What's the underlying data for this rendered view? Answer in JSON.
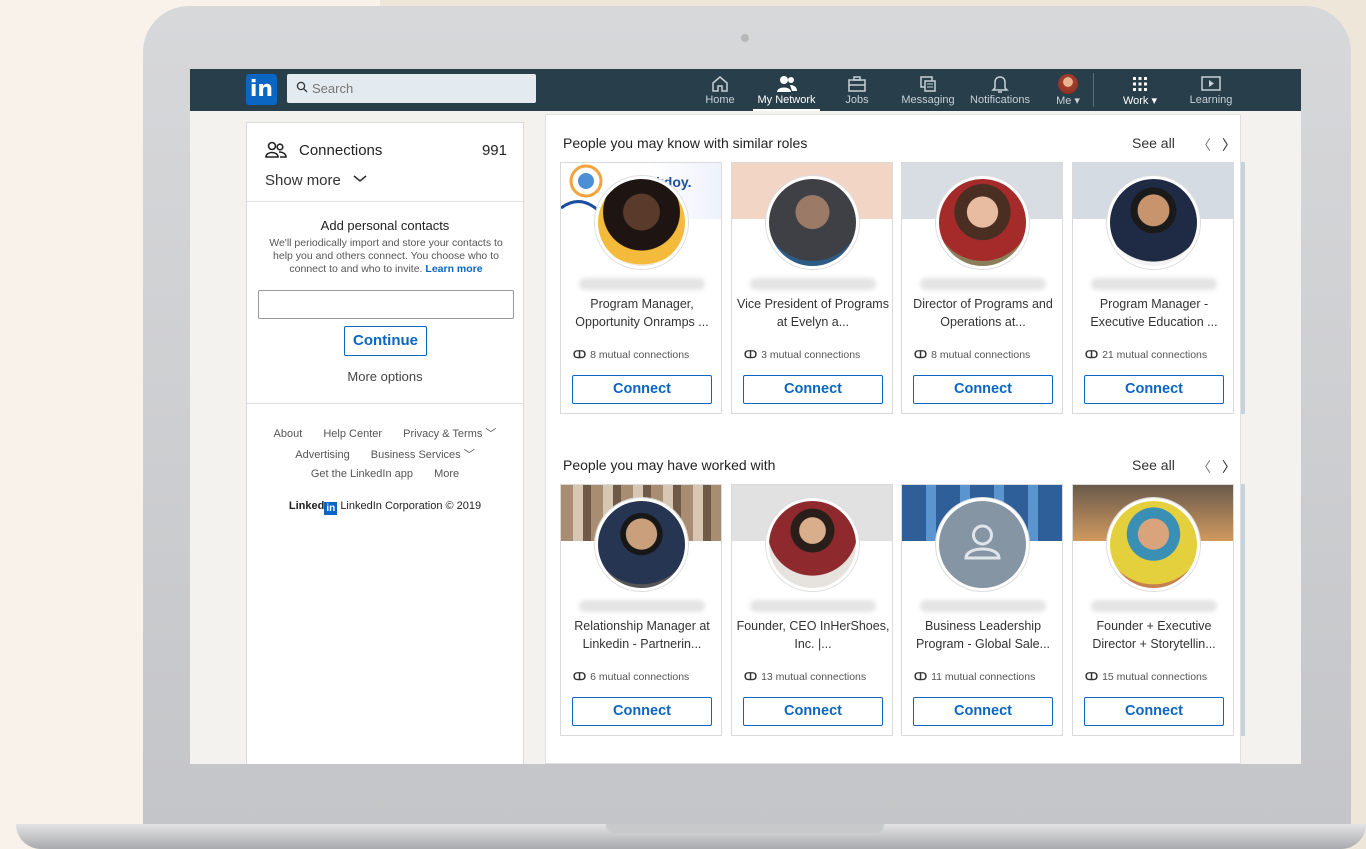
{
  "nav": {
    "search_placeholder": "Search",
    "items": [
      {
        "label": "Home",
        "icon": "home-icon"
      },
      {
        "label": "My Network",
        "icon": "network-icon",
        "active": true
      },
      {
        "label": "Jobs",
        "icon": "briefcase-icon"
      },
      {
        "label": "Messaging",
        "icon": "messaging-icon"
      },
      {
        "label": "Notifications",
        "icon": "bell-icon"
      },
      {
        "label": "Me ▾",
        "icon": "avatar"
      },
      {
        "label": "Work ▾",
        "icon": "grid-icon"
      },
      {
        "label": "Learning",
        "icon": "play-icon"
      }
    ]
  },
  "left": {
    "connections_label": "Connections",
    "connections_count": "991",
    "show_more": "Show more",
    "add_title": "Add personal contacts",
    "add_desc": "We'll periodically import and store your contacts to help you and others connect. You choose who to connect to and who to invite.",
    "learn_more": "Learn more",
    "continue": "Continue",
    "more_options": "More options",
    "footer": {
      "about": "About",
      "help": "Help Center",
      "privacy": "Privacy & Terms ﹀",
      "advertising": "Advertising",
      "business": "Business Services ﹀",
      "app": "Get the LinkedIn app",
      "more": "More"
    },
    "copyright_brand": "Linked",
    "copyright_in": "in",
    "copyright": "LinkedIn Corporation © 2019"
  },
  "sections": [
    {
      "title": "People you may know with similar roles",
      "see_all": "See all",
      "cards": [
        {
          "role": "Program Manager, Opportunity Onramps ...",
          "mutual": "8 mutual connections",
          "connect": "Connect",
          "banner": "#f6d6a8",
          "photo": "#3a2a22"
        },
        {
          "role": "Vice President of Programs at Evelyn a...",
          "mutual": "3 mutual connections",
          "connect": "Connect",
          "banner": "#f3d5c6",
          "photo": "#7a6656"
        },
        {
          "role": "Director of Programs and Operations at...",
          "mutual": "8 mutual connections",
          "connect": "Connect",
          "banner": "#d8dde3",
          "photo": "#9c3a35"
        },
        {
          "role": "Program Manager - Executive Education ...",
          "mutual": "21 mutual connections",
          "connect": "Connect",
          "banner": "#d5dbe2",
          "photo": "#23324a"
        }
      ]
    },
    {
      "title": "People you may have worked with",
      "see_all": "See all",
      "cards": [
        {
          "role": "Relationship Manager at Linkedin - Partnerin...",
          "mutual": "6 mutual connections",
          "connect": "Connect",
          "banner": "#b9a48e",
          "photo": "#253552"
        },
        {
          "role": "Founder, CEO InHerShoes, Inc. |...",
          "mutual": "13 mutual connections",
          "connect": "Connect",
          "banner": "#e1e1e1",
          "photo": "#8e2a2e"
        },
        {
          "role": "Business Leadership Program - Global Sale...",
          "mutual": "11 mutual connections",
          "connect": "Connect",
          "banner": "#3f77b5",
          "photo": "#8595a3"
        },
        {
          "role": "Founder + Executive Director + Storytellin...",
          "mutual": "15 mutual connections",
          "connect": "Connect",
          "banner": "#c88a4e",
          "photo": "#3a8fb5"
        }
      ]
    }
  ]
}
